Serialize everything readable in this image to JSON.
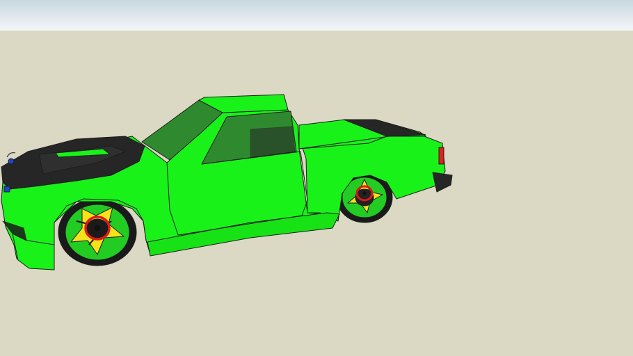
{
  "scene": {
    "description_visible_text": "",
    "colors": {
      "sky_top": "#c9d7e0",
      "sky_bottom": "#f3f6f8",
      "ground": "#dbd8c3",
      "body_green": "#19f219",
      "body_green_dark": "#10c810",
      "glass": "#2f8a2f",
      "hood_black": "#262626",
      "tire": "#1a1a1a",
      "rim_green": "#22cc22",
      "rim_yellow": "#f5e21a",
      "hub_red": "#e01818",
      "taillight_red": "#e02020",
      "outline": "#1d1d1d"
    }
  }
}
